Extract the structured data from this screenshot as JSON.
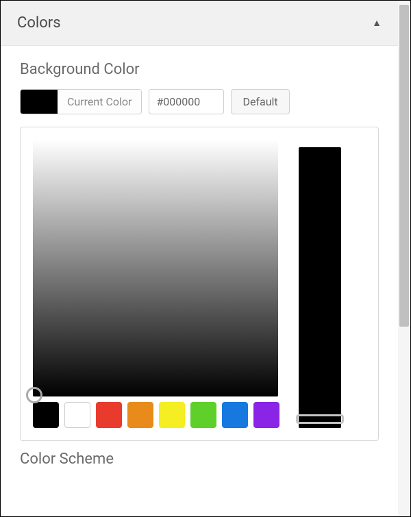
{
  "panel": {
    "title": "Colors"
  },
  "background_color": {
    "title": "Background Color",
    "current_label": "Current Color",
    "hex_value": "#000000",
    "default_label": "Default",
    "current_color": "#000000"
  },
  "palette": [
    {
      "name": "black",
      "hex": "#000000"
    },
    {
      "name": "white",
      "hex": "#ffffff"
    },
    {
      "name": "red",
      "hex": "#e83b2e"
    },
    {
      "name": "orange",
      "hex": "#e88b1a"
    },
    {
      "name": "yellow",
      "hex": "#f4ee22"
    },
    {
      "name": "green",
      "hex": "#5fd02a"
    },
    {
      "name": "blue",
      "hex": "#1778e0"
    },
    {
      "name": "purple",
      "hex": "#8a24e6"
    }
  ],
  "color_scheme": {
    "title": "Color Scheme"
  }
}
